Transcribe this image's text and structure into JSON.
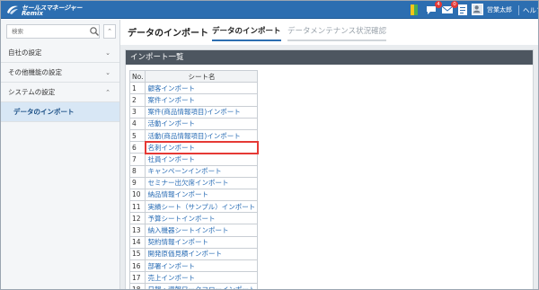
{
  "app": {
    "logo_line1": "セールスマネージャー",
    "logo_line2": "Remix"
  },
  "topbar": {
    "icons": [
      {
        "name": "mentor-icon",
        "badge": ""
      },
      {
        "name": "notification-icon",
        "badge": "4"
      },
      {
        "name": "mail-icon",
        "badge": "0"
      },
      {
        "name": "document-icon",
        "badge": ""
      }
    ],
    "user_name": "営業太郎",
    "help_label": "ヘルプ",
    "colors": {
      "bar": "#2c6eb1",
      "badge": "#e53935"
    }
  },
  "sidebar": {
    "search_placeholder": "検索",
    "collapse_icon": "chevron-up-icon",
    "items": [
      {
        "label": "自社の設定",
        "chevron": "⌄"
      },
      {
        "label": "その他機能の設定",
        "chevron": "⌄"
      },
      {
        "label": "システムの設定",
        "chevron": "⌃"
      },
      {
        "label": "データのインポート",
        "chevron": ""
      }
    ]
  },
  "main": {
    "title": "データのインポート",
    "tabs": [
      {
        "label": "データのインポート",
        "active": true
      },
      {
        "label": "データメンテナンス状況確認",
        "active": false
      }
    ],
    "panel_title": "インポート一覧",
    "table": {
      "headers": [
        "No.",
        "シート名"
      ],
      "rows": [
        {
          "no": "1",
          "name": "顧客インポート"
        },
        {
          "no": "2",
          "name": "案件インポート"
        },
        {
          "no": "3",
          "name": "案件(商品情報項目)インポート"
        },
        {
          "no": "4",
          "name": "活動インポート"
        },
        {
          "no": "5",
          "name": "活動(商品情報項目)インポート"
        },
        {
          "no": "6",
          "name": "名刺インポート"
        },
        {
          "no": "7",
          "name": "社員インポート"
        },
        {
          "no": "8",
          "name": "キャンペーンインポート"
        },
        {
          "no": "9",
          "name": "セミナー出欠席インポート"
        },
        {
          "no": "10",
          "name": "納品情報インポート"
        },
        {
          "no": "11",
          "name": "実績シート（サンプル）インポート"
        },
        {
          "no": "12",
          "name": "予算シートインポート"
        },
        {
          "no": "13",
          "name": "納入機器シートインポート"
        },
        {
          "no": "14",
          "name": "契約情報インポート"
        },
        {
          "no": "15",
          "name": "開発原価見積インポート"
        },
        {
          "no": "16",
          "name": "部署インポート"
        },
        {
          "no": "17",
          "name": "売上インポート"
        },
        {
          "no": "18",
          "name": "日報・週報ワークフローインポート"
        }
      ],
      "highlighted_row": 6,
      "link_color": "#2a6db5",
      "highlight_color": "#e53935"
    }
  }
}
